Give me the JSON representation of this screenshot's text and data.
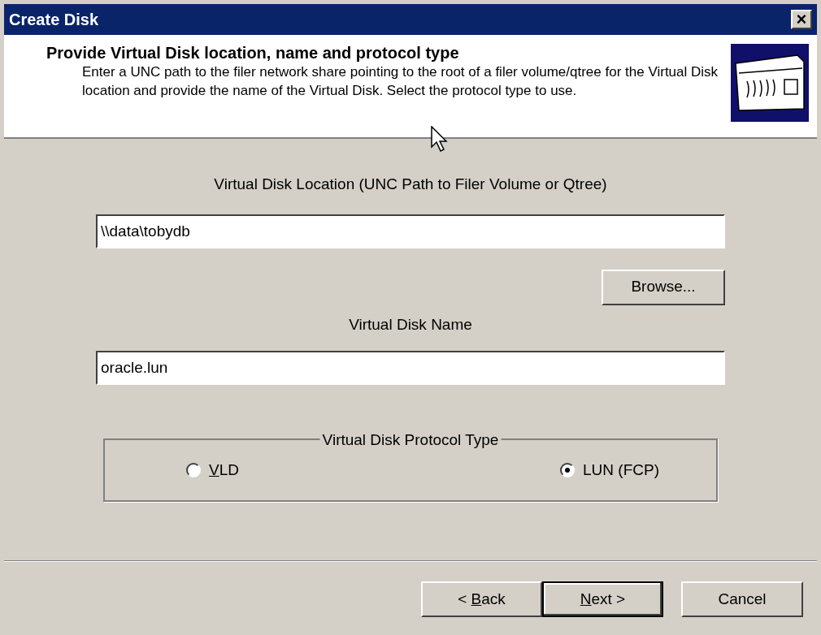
{
  "window": {
    "title": "Create Disk",
    "close": "×"
  },
  "header": {
    "title": "Provide Virtual Disk location, name and protocol type",
    "description": "Enter a UNC path to the filer network share pointing to the root of a filer volume/qtree for the Virtual Disk location and provide the name of the Virtual Disk. Select the protocol type to use."
  },
  "location": {
    "label": "Virtual Disk Location (UNC Path to Filer Volume or Qtree)",
    "value": "\\\\data\\tobydb",
    "browse": "Browse..."
  },
  "name": {
    "label": "Virtual Disk Name",
    "value": "oracle.lun"
  },
  "protocol": {
    "title": "Virtual Disk Protocol Type",
    "options": [
      {
        "key": "V",
        "after": "LD",
        "selected": false
      },
      {
        "after": "LUN (FCP)",
        "selected": true
      }
    ]
  },
  "buttons": [
    {
      "before": "< ",
      "key": "B",
      "after": "ack",
      "default": false
    },
    {
      "key": "N",
      "after": "ext >",
      "default": true
    },
    {
      "after": "Cancel",
      "default": false
    }
  ]
}
